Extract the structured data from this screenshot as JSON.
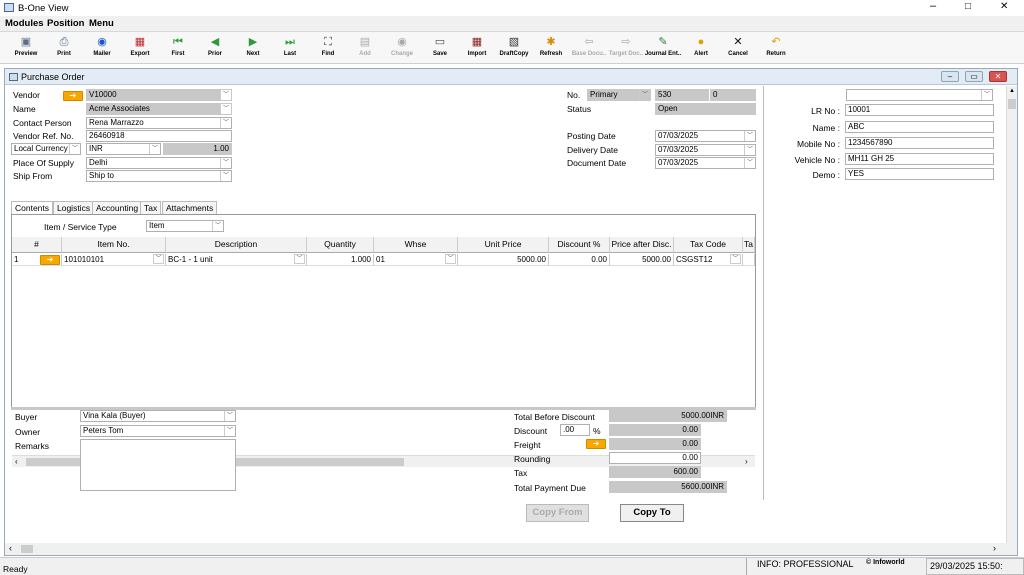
{
  "app": {
    "title": "B-One View"
  },
  "window_controls": {
    "minimize": "–",
    "maximize": "□",
    "close": "✕"
  },
  "menu": [
    "Modules",
    "Position",
    "Menu"
  ],
  "toolbar": [
    {
      "label": "Preview",
      "icon": "preview-icon",
      "glyph": "▣",
      "color": "#5a6e8a",
      "disabled": false
    },
    {
      "label": "Print",
      "icon": "print-icon",
      "glyph": "⎙",
      "color": "#506a8c",
      "disabled": false
    },
    {
      "label": "Mailer",
      "icon": "mail-icon",
      "glyph": "◉",
      "color": "#1a55c8",
      "disabled": false
    },
    {
      "label": "Export",
      "icon": "export-icon",
      "glyph": "▦",
      "color": "#c0282d",
      "disabled": false
    },
    {
      "label": "First",
      "icon": "first-icon",
      "glyph": "⏮",
      "color": "#2e9a3a",
      "disabled": false
    },
    {
      "label": "Prior",
      "icon": "prior-icon",
      "glyph": "◀",
      "color": "#2e9a3a",
      "disabled": false
    },
    {
      "label": "Next",
      "icon": "next-icon",
      "glyph": "▶",
      "color": "#2e9a3a",
      "disabled": false
    },
    {
      "label": "Last",
      "icon": "last-icon",
      "glyph": "⏭",
      "color": "#2e9a3a",
      "disabled": false
    },
    {
      "label": "Find",
      "icon": "find-icon",
      "glyph": "⛶",
      "color": "#333333",
      "disabled": false
    },
    {
      "label": "Add",
      "icon": "add-icon",
      "glyph": "▤",
      "color": "#999999",
      "disabled": true
    },
    {
      "label": "Change",
      "icon": "change-icon",
      "glyph": "◉",
      "color": "#999999",
      "disabled": true
    },
    {
      "label": "Save",
      "icon": "save-icon",
      "glyph": "▭",
      "color": "#444444",
      "disabled": false
    },
    {
      "label": "Import",
      "icon": "import-icon",
      "glyph": "▦",
      "color": "#8a1c1c",
      "disabled": false
    },
    {
      "label": "DraftCopy",
      "icon": "draftcopy-icon",
      "glyph": "▧",
      "color": "#333333",
      "disabled": false
    },
    {
      "label": "Refresh",
      "icon": "refresh-icon",
      "glyph": "✱",
      "color": "#d98a00",
      "disabled": false
    },
    {
      "label": "Base Docu..",
      "icon": "base-doc-icon",
      "glyph": "⇦",
      "color": "#666666",
      "disabled": true
    },
    {
      "label": "Target Doc..",
      "icon": "target-doc-icon",
      "glyph": "⇨",
      "color": "#666666",
      "disabled": true
    },
    {
      "label": "Journal Ent..",
      "icon": "journal-icon",
      "glyph": "✎",
      "color": "#2e7a3a",
      "disabled": false
    },
    {
      "label": "Alert",
      "icon": "alert-icon",
      "glyph": "●",
      "color": "#e0a000",
      "disabled": false
    },
    {
      "label": "Cancel",
      "icon": "cancel-icon",
      "glyph": "✕",
      "color": "#111111",
      "disabled": false
    },
    {
      "label": "Return",
      "icon": "return-icon",
      "glyph": "↶",
      "color": "#e0a000",
      "disabled": false
    }
  ],
  "document": {
    "title": "Purchase Order"
  },
  "header_left": {
    "vendor_label": "Vendor",
    "vendor_value": "V10000",
    "name_label": "Name",
    "name_value": "Acme Associates",
    "contact_label": "Contact Person",
    "contact_value": "Rena Marrazzo",
    "vendor_ref_label": "Vendor Ref. No.",
    "vendor_ref_value": "26460918",
    "currency_label": "Local Currency",
    "currency_value": "INR",
    "rate_value": "1.00",
    "supply_label": "Place Of Supply",
    "supply_value": "Delhi",
    "shipfrom_label": "Ship From",
    "shipfrom_value": "Ship to"
  },
  "header_right": {
    "no_label": "No.",
    "series": "Primary",
    "doc_no": "530",
    "doc_ext": "0",
    "status_label": "Status",
    "status_value": "Open",
    "posting_label": "Posting Date",
    "posting_value": "07/03/2025",
    "delivery_label": "Delivery Date",
    "delivery_value": "07/03/2025",
    "docdate_label": "Document Date",
    "docdate_value": "07/03/2025"
  },
  "udf": {
    "lr_label": "LR No :",
    "lr_value": "10001",
    "name_label": "Name :",
    "name_value": "ABC",
    "mobile_label": "Mobile No :",
    "mobile_value": "1234567890",
    "vehicle_label": "Vehicle No :",
    "vehicle_value": "MH11 GH 25",
    "demo_label": "Demo :",
    "demo_value": "YES"
  },
  "tabs": [
    "Contents",
    "Logistics",
    "Accounting",
    "Tax",
    "Attachments"
  ],
  "item_type": {
    "label": "Item / Service Type",
    "value": "Item"
  },
  "grid": {
    "headers": [
      "#",
      "Item No.",
      "Description",
      "Quantity",
      "Whse",
      "Unit Price",
      "Discount %",
      "Price after Disc.",
      "Tax Code",
      "Ta"
    ],
    "rows": [
      [
        "1",
        "101010101",
        "BC-1 - 1 unit",
        "1.000",
        "01",
        "5000.00",
        "0.00",
        "5000.00",
        "CSGST12",
        ""
      ]
    ]
  },
  "footer_left": {
    "buyer_label": "Buyer",
    "buyer_value": "Vina Kala (Buyer)",
    "owner_label": "Owner",
    "owner_value": "Peters Tom",
    "remarks_label": "Remarks"
  },
  "totals": {
    "before_label": "Total Before Discount",
    "before_value": "5000.00INR",
    "discount_label": "Discount",
    "discount_pct": ".00",
    "pct_sign": "%",
    "discount_value": "0.00",
    "freight_label": "Freight",
    "freight_value": "0.00",
    "rounding_label": "Rounding",
    "rounding_value": "0.00",
    "tax_label": "Tax",
    "tax_value": "600.00",
    "due_label": "Total Payment Due",
    "due_value": "5600.00INR"
  },
  "buttons": {
    "copy_from": "Copy From",
    "copy_to": "Copy To"
  },
  "statusbar": {
    "ready": "Ready",
    "info": "INFO: PROFESSIONAL",
    "brand": "© Infoworld",
    "datetime": "29/03/2025 15:50:"
  }
}
